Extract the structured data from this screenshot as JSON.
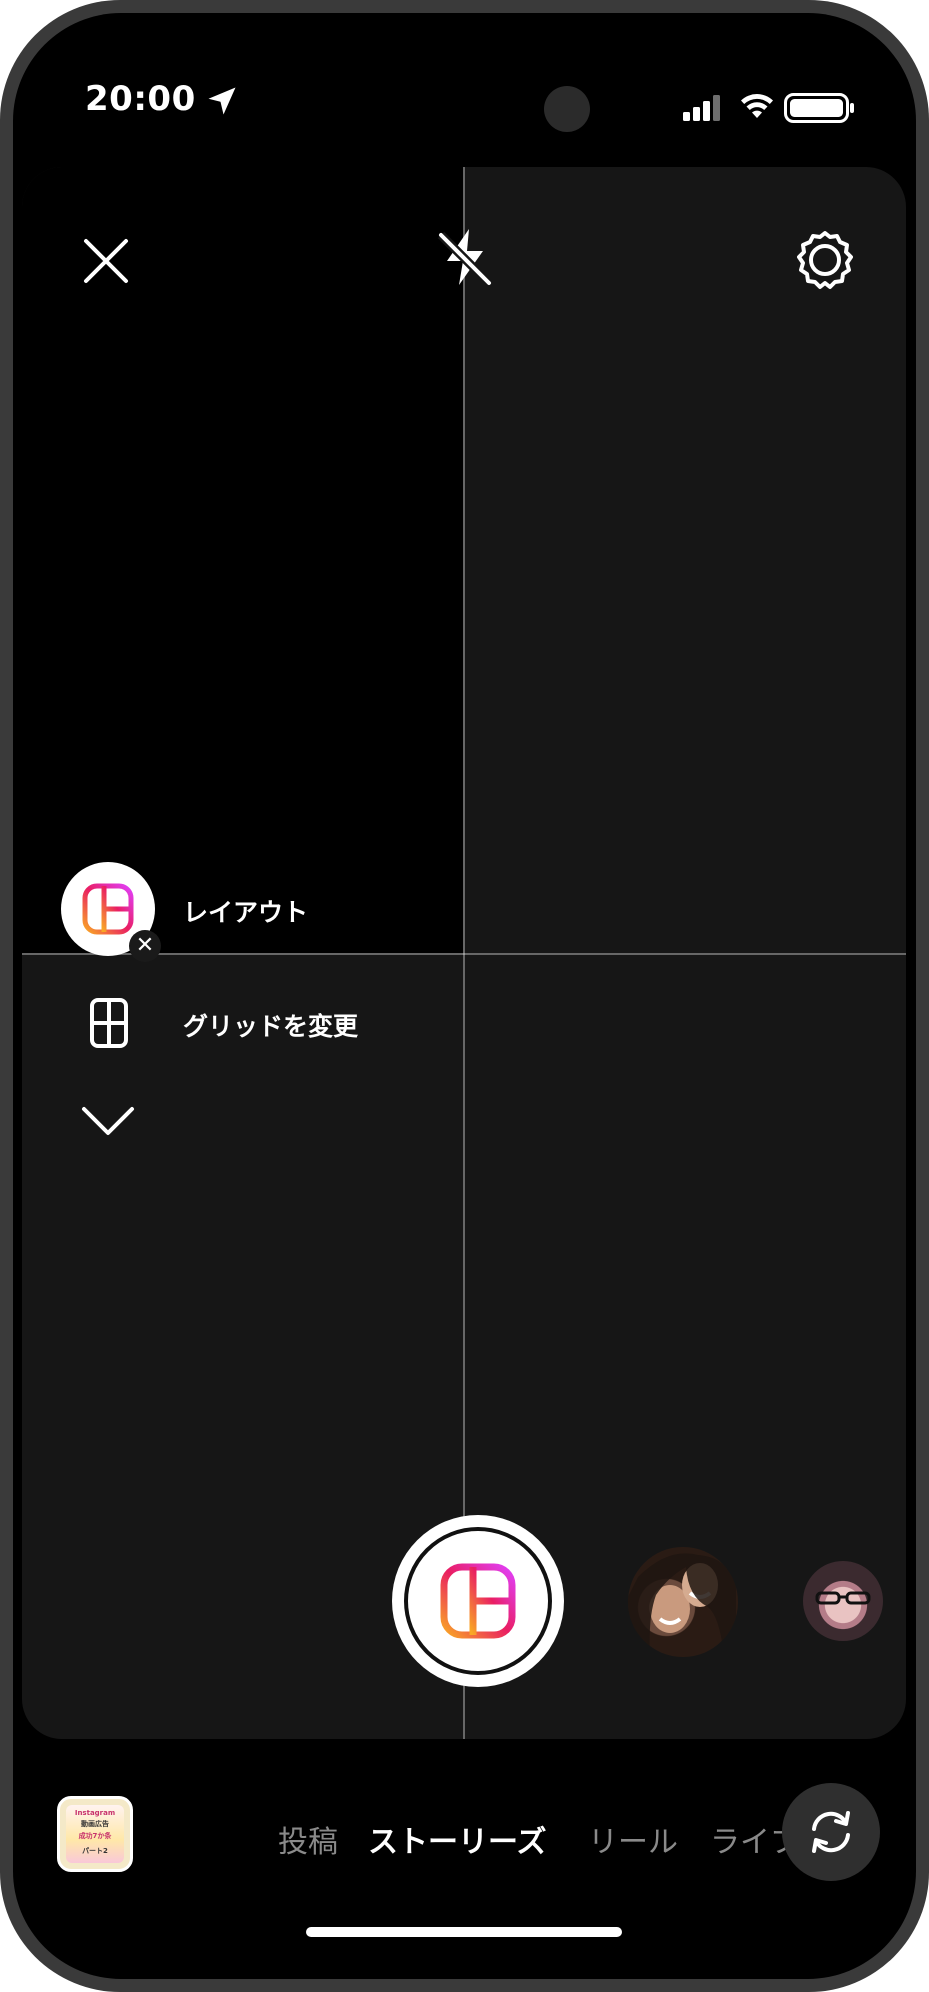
{
  "status_bar": {
    "time": "20:00"
  },
  "camera": {
    "layout_mode": {
      "label": "レイアウト",
      "remove_symbol": "✕"
    },
    "grid_option": {
      "label": "グリッドを変更"
    }
  },
  "gallery_thumbnail": {
    "lines": [
      "Instagram",
      "動画広告",
      "成功7か条",
      "パート2"
    ]
  },
  "mode_tabs": {
    "post": "投稿",
    "stories": "ストーリーズ",
    "reels": "リール",
    "live": "ライブ"
  },
  "colors": {
    "gradient_start": "#f9a825",
    "gradient_mid": "#e91e63",
    "gradient_end": "#e040fb"
  }
}
